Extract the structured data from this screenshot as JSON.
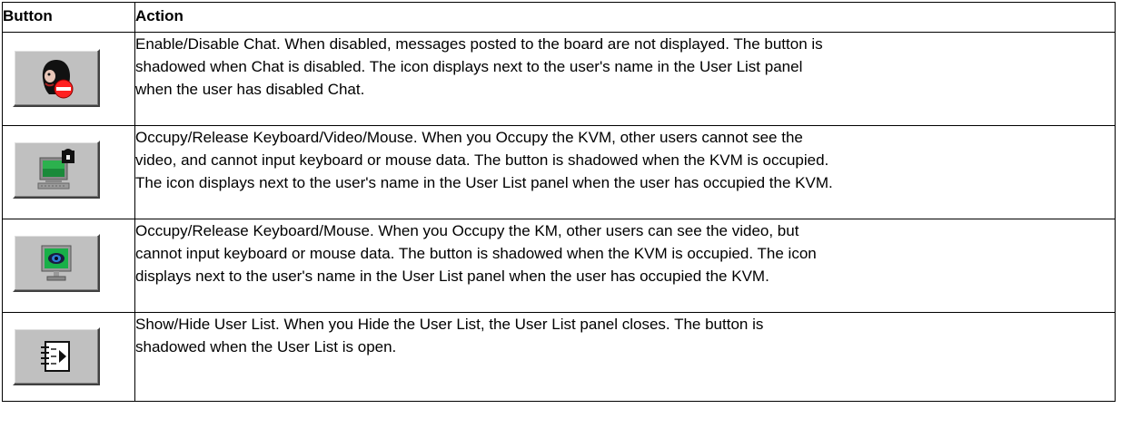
{
  "table": {
    "header": {
      "button": "Button",
      "action": "Action"
    },
    "rows": [
      {
        "icon": "chat-disabled-icon",
        "lines": [
          "Enable/Disable Chat. When disabled, messages posted to the board are not displayed. The button is",
          "shadowed when Chat is disabled. The icon displays next to the user's name in the User List panel",
          "when the user has disabled Chat."
        ]
      },
      {
        "icon": "occupy-kvm-icon",
        "lines": [
          "Occupy/Release Keyboard/Video/Mouse. When you Occupy the KVM, other users cannot see the",
          "video, and cannot input keyboard or mouse data. The button is shadowed when the KVM is occupied.",
          "The icon displays next to the user's name in the User List panel when the user has occupied the KVM."
        ]
      },
      {
        "icon": "occupy-km-icon",
        "lines": [
          "Occupy/Release Keyboard/Mouse. When you Occupy the KM, other users can see the video, but",
          "cannot input keyboard or mouse data. The button is shadowed when the KVM is occupied. The icon",
          "displays next to the user's name in the User List panel when the user has occupied the KVM."
        ]
      },
      {
        "icon": "user-list-icon",
        "lines": [
          "Show/Hide User List. When you Hide the User List, the User List panel closes. The button is",
          "shadowed when the User List is open."
        ]
      }
    ]
  }
}
